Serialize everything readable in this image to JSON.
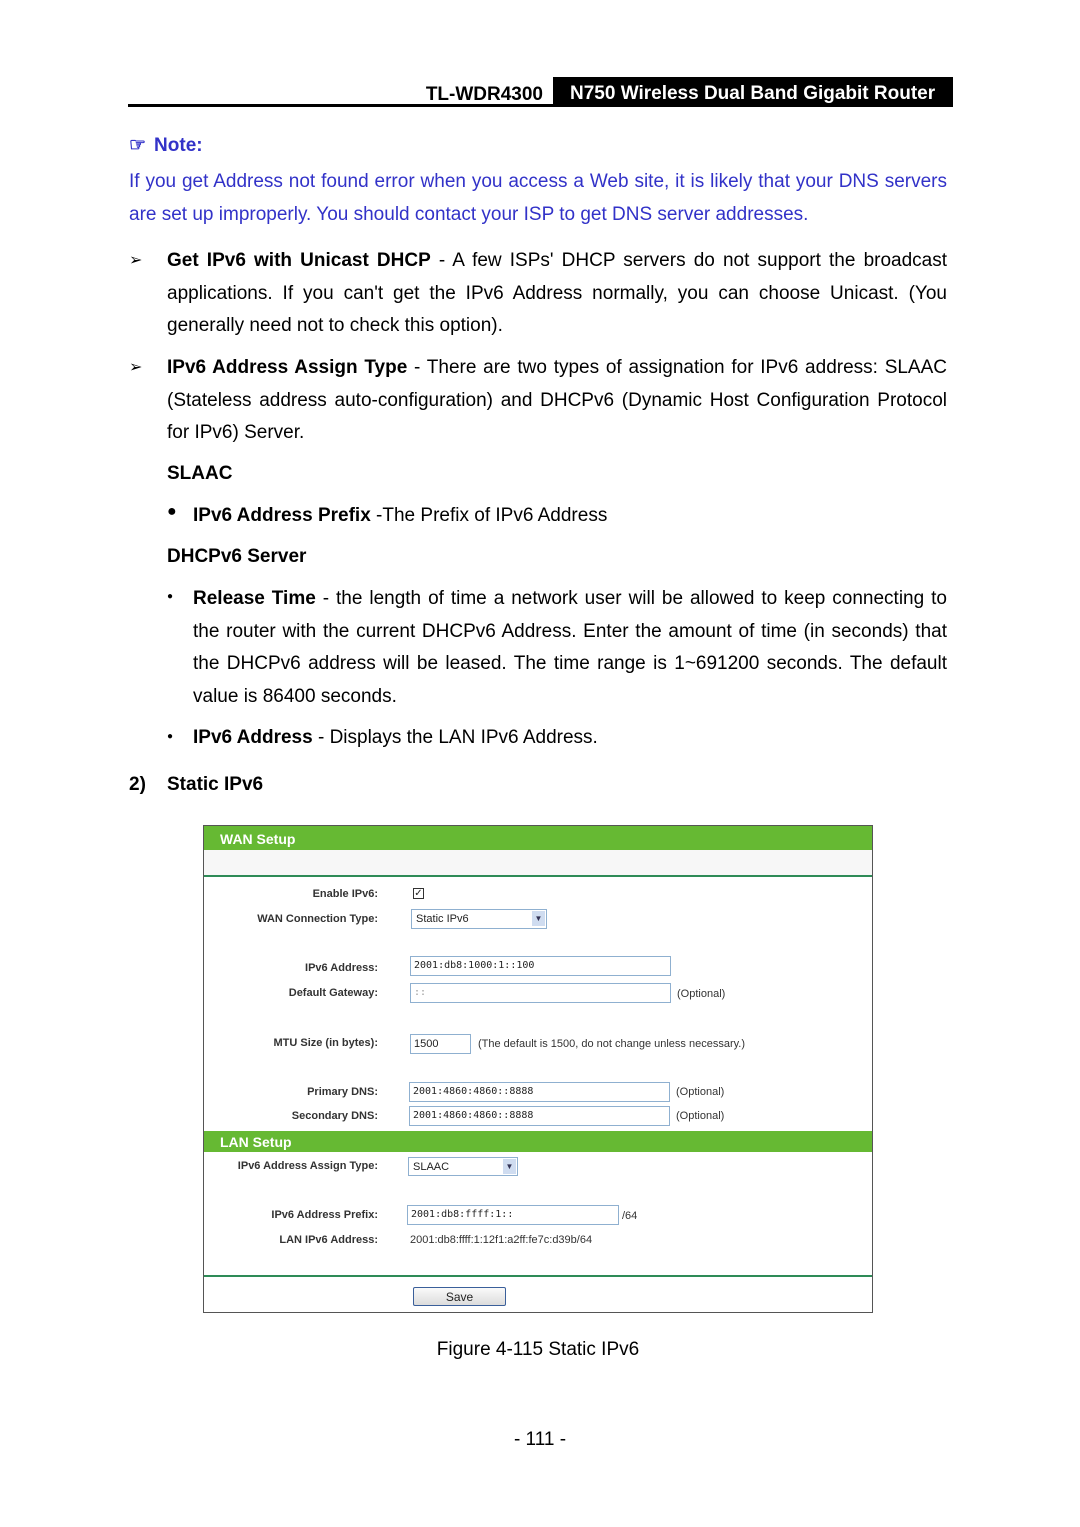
{
  "header": {
    "model": "TL-WDR4300",
    "title": "N750 Wireless Dual Band Gigabit Router"
  },
  "note": {
    "icon": "pointing-hand-icon",
    "title": "Note:",
    "text": "If you get Address not found error when you access a Web site, it is likely that your DNS servers are set up improperly. You should contact your ISP to get DNS server addresses.",
    "color": "#3232c8"
  },
  "items": [
    {
      "term": "Get IPv6 with Unicast DHCP",
      "text": " - A few ISPs' DHCP servers do not support the broadcast applications. If you can't get the IPv6 Address normally, you can choose Unicast. (You generally need not to check this option)."
    },
    {
      "term": "IPv6 Address Assign Type",
      "text": " - There are two types of assignation for IPv6 address: SLAAC (Stateless address auto-configuration) and DHCPv6 (Dynamic Host Configuration Protocol for IPv6) Server."
    }
  ],
  "slaac": {
    "heading": "SLAAC",
    "bullets": [
      {
        "term": "IPv6 Address Prefix",
        "text": " -The Prefix of IPv6 Address"
      }
    ]
  },
  "dhcpv6": {
    "heading": "DHCPv6 Server",
    "bullets": [
      {
        "term": "Release Time",
        "text": " - the length of time a network user will be allowed to keep connecting to the router with the current DHCPv6 Address. Enter the amount of time (in seconds) that the DHCPv6 address will be leased. The time range is 1~691200 seconds. The default value is 86400 seconds."
      },
      {
        "term": "IPv6 Address",
        "text": " - Displays the LAN IPv6 Address."
      }
    ]
  },
  "section": {
    "number": "2)",
    "title": "Static IPv6"
  },
  "ui": {
    "wan_title": "WAN Setup",
    "enable_ipv6_label": "Enable IPv6:",
    "enable_ipv6_checked": true,
    "wan_type_label": "WAN Connection Type:",
    "wan_type_value": "Static IPv6",
    "ipv6_address_label": "IPv6 Address:",
    "ipv6_address_value": "2001:db8:1000:1::100",
    "gateway_label": "Default Gateway:",
    "gateway_value": "::",
    "optional": "(Optional)",
    "mtu_label": "MTU Size (in bytes):",
    "mtu_value": "1500",
    "mtu_hint": "(The default is 1500, do not change unless necessary.)",
    "primary_dns_label": "Primary DNS:",
    "primary_dns_value": "2001:4860:4860::8888",
    "secondary_dns_label": "Secondary DNS:",
    "secondary_dns_value": "2001:4860:4860::8888",
    "lan_title": "LAN Setup",
    "assign_type_label": "IPv6 Address Assign Type:",
    "assign_type_value": "SLAAC",
    "prefix_label": "IPv6 Address Prefix:",
    "prefix_value": "2001:db8:ffff:1::",
    "prefix_suffix": "/64",
    "lan_address_label": "LAN IPv6 Address:",
    "lan_address_value": "2001:db8:ffff:1:12f1:a2ff:fe7c:d39b/64",
    "save_label": "Save",
    "accent": "#66b933"
  },
  "caption": "Figure 4-115 Static IPv6",
  "page_number": "- 111 -"
}
